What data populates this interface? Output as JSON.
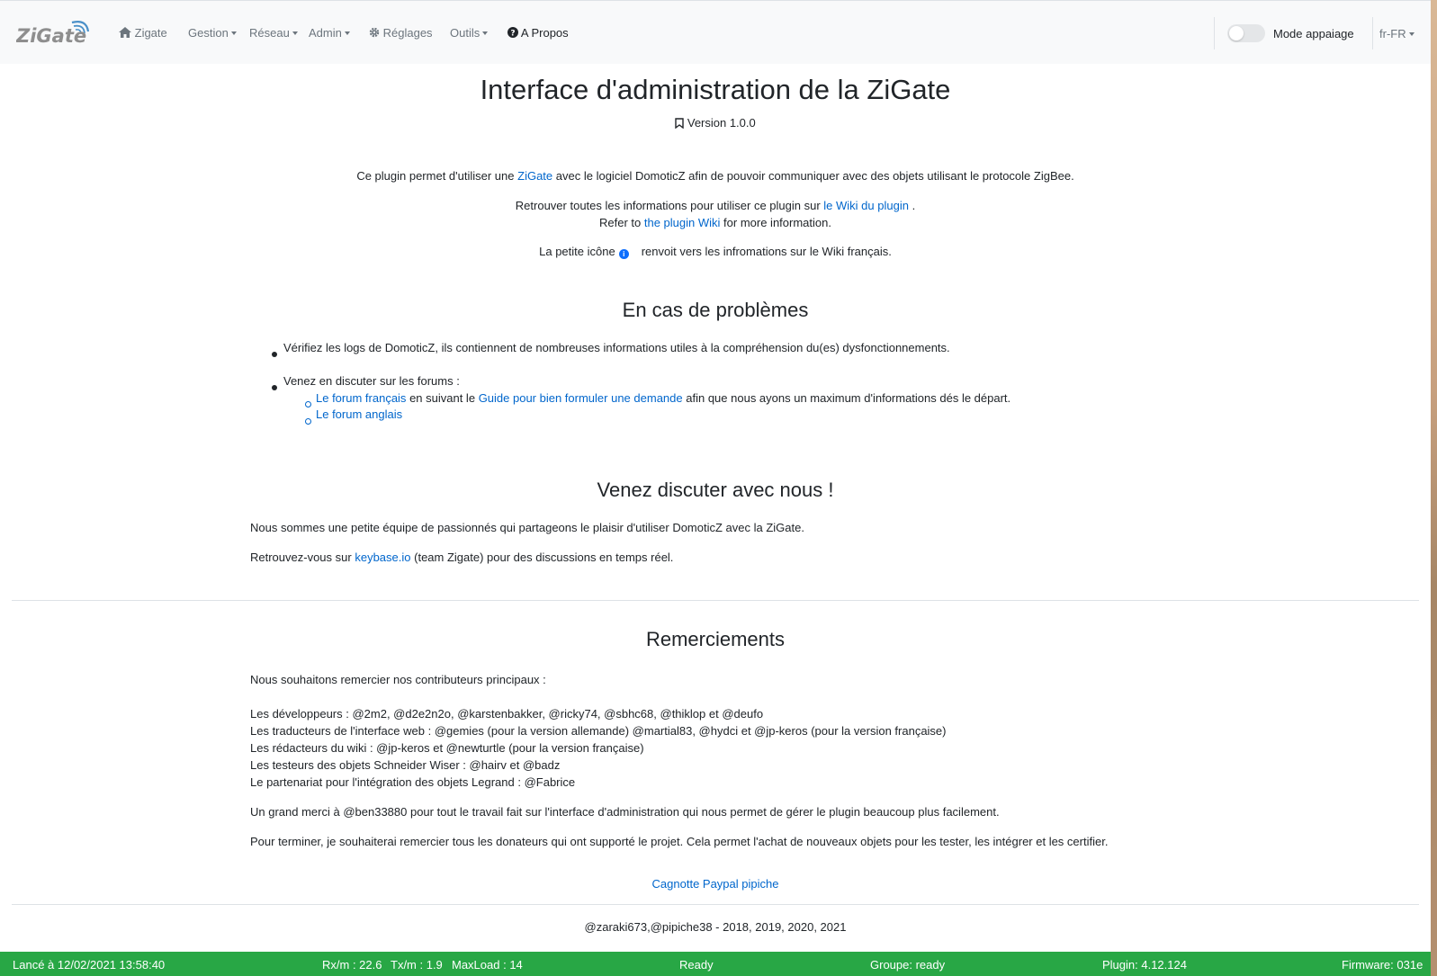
{
  "navbar": {
    "brand_text": "ZiGate",
    "items": [
      {
        "label": "Zigate",
        "icon": "home-icon",
        "dropdown": false
      },
      {
        "label": "Gestion",
        "dropdown": true
      },
      {
        "label": "Réseau",
        "dropdown": true
      },
      {
        "label": "Admin",
        "dropdown": true
      },
      {
        "label": "Réglages",
        "icon": "gear-icon",
        "dropdown": false
      },
      {
        "label": "Outils",
        "dropdown": true
      },
      {
        "label": "A Propos",
        "icon": "question-circle-icon",
        "dropdown": false
      }
    ],
    "pairing_mode_label": "Mode appaiage",
    "pairing_mode_enabled": false,
    "language": "fr-FR"
  },
  "header": {
    "title": "Interface d'administration de la ZiGate",
    "version": "Version 1.0.0"
  },
  "intro": {
    "line1_pre": "Ce plugin permet d'utiliser une",
    "line1_link": "ZiGate",
    "line1_post": "avec le logiciel DomoticZ afin de pouvoir communiquer avec des objets utilisant le protocole ZigBee.",
    "line2_pre": "Retrouver toutes les informations pour utiliser ce plugin sur",
    "line2_link": "le Wiki du plugin",
    "line2_post": ".",
    "line3_pre": "Refer to",
    "line3_link": "the plugin Wiki",
    "line3_post": "for more information.",
    "line4_pre": "La petite icône",
    "line4_post": "renvoit vers les infromations sur le Wiki français."
  },
  "problems": {
    "heading": "En cas de problèmes",
    "bullet1": "Vérifiez les logs de DomoticZ, ils contiennent de nombreuses informations utiles à la compréhension du(es) dysfonctionnements.",
    "bullet2": "Venez en discuter sur les forums :",
    "sub1_link1": "Le forum français",
    "sub1_mid": "en suivant le",
    "sub1_link2": "Guide pour bien formuler une demande",
    "sub1_post": "afin que nous ayons un maximum d'informations dés le départ.",
    "sub2_link": "Le forum anglais"
  },
  "discuss": {
    "heading": "Venez discuter avec nous !",
    "p1": "Nous sommes une petite équipe de passionnés qui partageons le plaisir d'utiliser DomoticZ avec la ZiGate.",
    "p2_pre": "Retrouvez-vous sur",
    "p2_link": "keybase.io",
    "p2_post": "(team Zigate) pour des discussions en temps réel."
  },
  "thanks": {
    "heading": "Remerciements",
    "intro": "Nous souhaitons remercier nos contributeurs principaux :",
    "lines": [
      "Les développeurs : @2m2, @d2e2n2o, @karstenbakker, @ricky74, @sbhc68, @thiklop et @deufo",
      "Les traducteurs de l'interface web : @gemies (pour la version allemande) @martial83, @hydci et @jp-keros (pour la version française)",
      "Les rédacteurs du wiki : @jp-keros et @newturtle (pour la version française)",
      "Les testeurs des objets Schneider Wiser : @hairv et @badz",
      "Le partenariat pour l'intégration des objets Legrand : @Fabrice"
    ],
    "p_ben": "Un grand merci à @ben33880 pour tout le travail fait sur l'interface d'administration qui nous permet de gérer le plugin beaucoup plus facilement.",
    "p_donors": "Pour terminer, je souhaiterai remercier tous les donateurs qui ont supporté le projet. Cela permet l'achat de nouveaux objets pour les tester, les intégrer et les certifier.",
    "paypal_link": "Cagnotte Paypal pipiche"
  },
  "footer": {
    "credits": "@zaraki673,@pipiche38 - 2018, 2019, 2020, 2021"
  },
  "statusbar": {
    "launched": "Lancé à 12/02/2021 13:58:40",
    "rx": "Rx/m : 22.6",
    "tx": "Tx/m : 1.9",
    "maxload": "MaxLoad : 14",
    "status": "Ready",
    "group": "Groupe: ready",
    "plugin": "Plugin: 4.12.124",
    "firmware": "Firmware: 031e",
    "color": "#28a745"
  },
  "colors": {
    "link": "#0066cc",
    "navbar_bg": "#f8f9fa",
    "status_bg": "#28a745"
  }
}
